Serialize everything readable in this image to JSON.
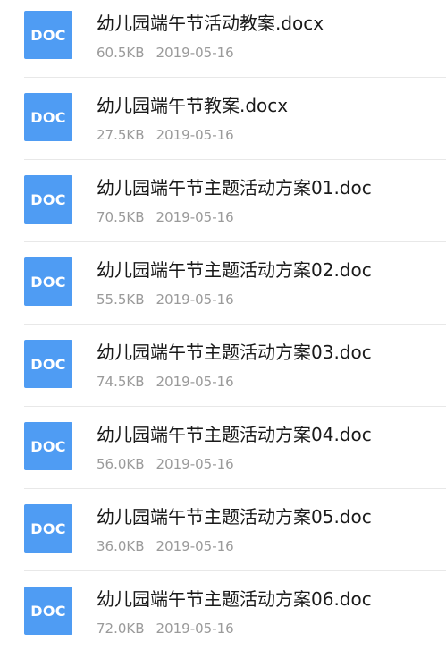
{
  "files": [
    {
      "icon_label": "DOC",
      "name": "幼儿园端午节活动教案.docx",
      "size": "60.5KB",
      "date": "2019-05-16"
    },
    {
      "icon_label": "DOC",
      "name": "幼儿园端午节教案.docx",
      "size": "27.5KB",
      "date": "2019-05-16"
    },
    {
      "icon_label": "DOC",
      "name": "幼儿园端午节主题活动方案01.doc",
      "size": "70.5KB",
      "date": "2019-05-16"
    },
    {
      "icon_label": "DOC",
      "name": "幼儿园端午节主题活动方案02.doc",
      "size": "55.5KB",
      "date": "2019-05-16"
    },
    {
      "icon_label": "DOC",
      "name": "幼儿园端午节主题活动方案03.doc",
      "size": "74.5KB",
      "date": "2019-05-16"
    },
    {
      "icon_label": "DOC",
      "name": "幼儿园端午节主题活动方案04.doc",
      "size": "56.0KB",
      "date": "2019-05-16"
    },
    {
      "icon_label": "DOC",
      "name": "幼儿园端午节主题活动方案05.doc",
      "size": "36.0KB",
      "date": "2019-05-16"
    },
    {
      "icon_label": "DOC",
      "name": "幼儿园端午节主题活动方案06.doc",
      "size": "72.0KB",
      "date": "2019-05-16"
    }
  ],
  "colors": {
    "doc_icon_bg": "#4f9cf3"
  },
  "icons": {
    "file_type": "doc-file-icon"
  }
}
